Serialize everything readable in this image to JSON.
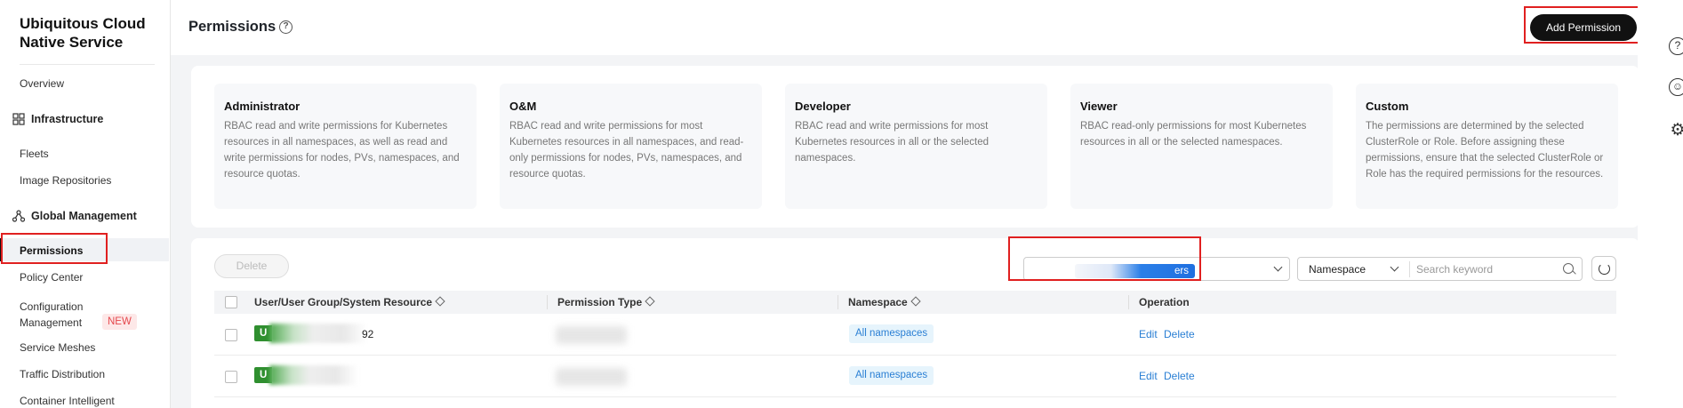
{
  "sidebar": {
    "brand": "Ubiquitous Cloud Native Service",
    "overview": "Overview",
    "sections": [
      {
        "label": "Infrastructure",
        "icon": "grid-icon"
      },
      {
        "label": "Global Management",
        "icon": "nodes-icon"
      }
    ],
    "infra_items": [
      "Fleets",
      "Image Repositories"
    ],
    "global_items": [
      "Permissions",
      "Policy Center",
      "Configuration Management",
      "Service Meshes",
      "Traffic Distribution",
      "Container Intelligent"
    ],
    "new_badge": "NEW",
    "active_item": "Permissions"
  },
  "header": {
    "title": "Permissions",
    "help_icon": "?",
    "add_button": "Add Permission"
  },
  "right_rail": {
    "icons": [
      "question-icon",
      "smiley-icon",
      "gear-icon"
    ],
    "help_glyph": "?",
    "smiley_glyph": "☺",
    "gear_glyph": "⚙"
  },
  "cards": [
    {
      "title": "Administrator",
      "desc": "RBAC read and write permissions for Kubernetes resources in all namespaces, as well as read and write permissions for nodes, PVs, namespaces, and resource quotas."
    },
    {
      "title": "O&M",
      "desc": "RBAC read and write permissions for most Kubernetes resources in all namespaces, and read-only permissions for nodes, PVs, namespaces, and resource quotas."
    },
    {
      "title": "Developer",
      "desc": "RBAC read and write permissions for most Kubernetes resources in all or the selected namespaces."
    },
    {
      "title": "Viewer",
      "desc": "RBAC read-only permissions for most Kubernetes resources in all or the selected namespaces."
    },
    {
      "title": "Custom",
      "desc": "The permissions are determined by the selected ClusterRole or Role. Before assigning these permissions, ensure that the selected ClusterRole or Role has the required permissions for the resources."
    }
  ],
  "toolbar": {
    "delete_label": "Delete",
    "filter_value_suffix": "ers",
    "namespace_label": "Namespace",
    "search_placeholder": "Search keyword"
  },
  "table": {
    "columns": [
      "User/User Group/System Resource",
      "Permission Type",
      "Namespace",
      "Operation"
    ],
    "rows": [
      {
        "user_prefix": "U",
        "user_suffix": "92",
        "namespace": "All namespaces",
        "edit": "Edit",
        "delete": "Delete"
      },
      {
        "user_prefix": "U",
        "user_suffix": "",
        "namespace": "All namespaces",
        "edit": "Edit",
        "delete": "Delete"
      }
    ]
  }
}
